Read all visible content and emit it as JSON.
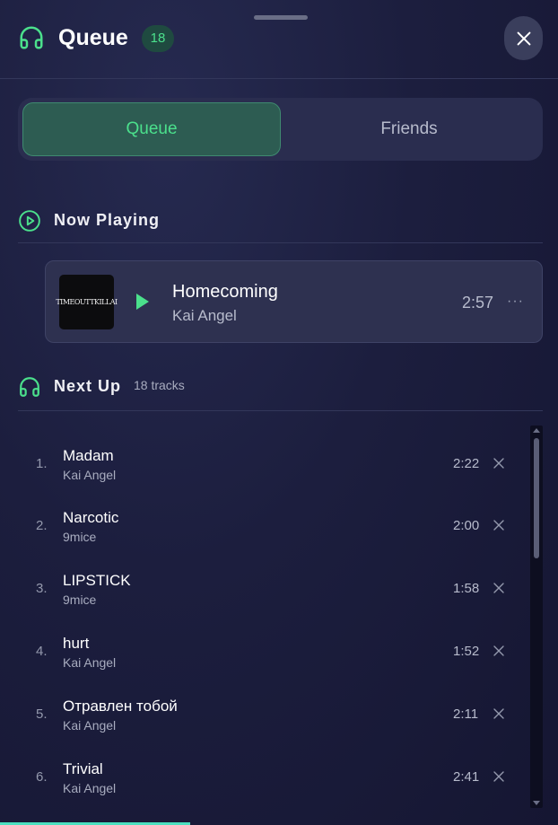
{
  "header": {
    "title": "Queue",
    "count": "18",
    "icon": "headphones-icon",
    "close_icon": "close-icon"
  },
  "tabs": [
    {
      "label": "Queue",
      "active": true
    },
    {
      "label": "Friends",
      "active": false
    }
  ],
  "now_playing": {
    "heading": "Now Playing",
    "icon": "play-circle-icon",
    "track": {
      "cover_text": "TIMEOUTTKILLAI",
      "title": "Homecoming",
      "artist": "Kai Angel",
      "duration": "2:57"
    }
  },
  "next_up": {
    "heading": "Next Up",
    "count_label": "18 tracks",
    "icon": "headphones-icon",
    "tracks": [
      {
        "num": "1.",
        "title": "Madam",
        "artist": "Kai Angel",
        "duration": "2:22"
      },
      {
        "num": "2.",
        "title": "Narcotic",
        "artist": "9mice",
        "duration": "2:00"
      },
      {
        "num": "3.",
        "title": "LIPSTICK",
        "artist": "9mice",
        "duration": "1:58"
      },
      {
        "num": "4.",
        "title": "hurt",
        "artist": "Kai Angel",
        "duration": "1:52"
      },
      {
        "num": "5.",
        "title": "Отравлен тобой",
        "artist": "Kai Angel",
        "duration": "2:11"
      },
      {
        "num": "6.",
        "title": "Trivial",
        "artist": "Kai Angel",
        "duration": "2:41"
      }
    ]
  },
  "colors": {
    "accent": "#4be08c",
    "background": "#1c1e3e",
    "card": "#2e3150"
  }
}
